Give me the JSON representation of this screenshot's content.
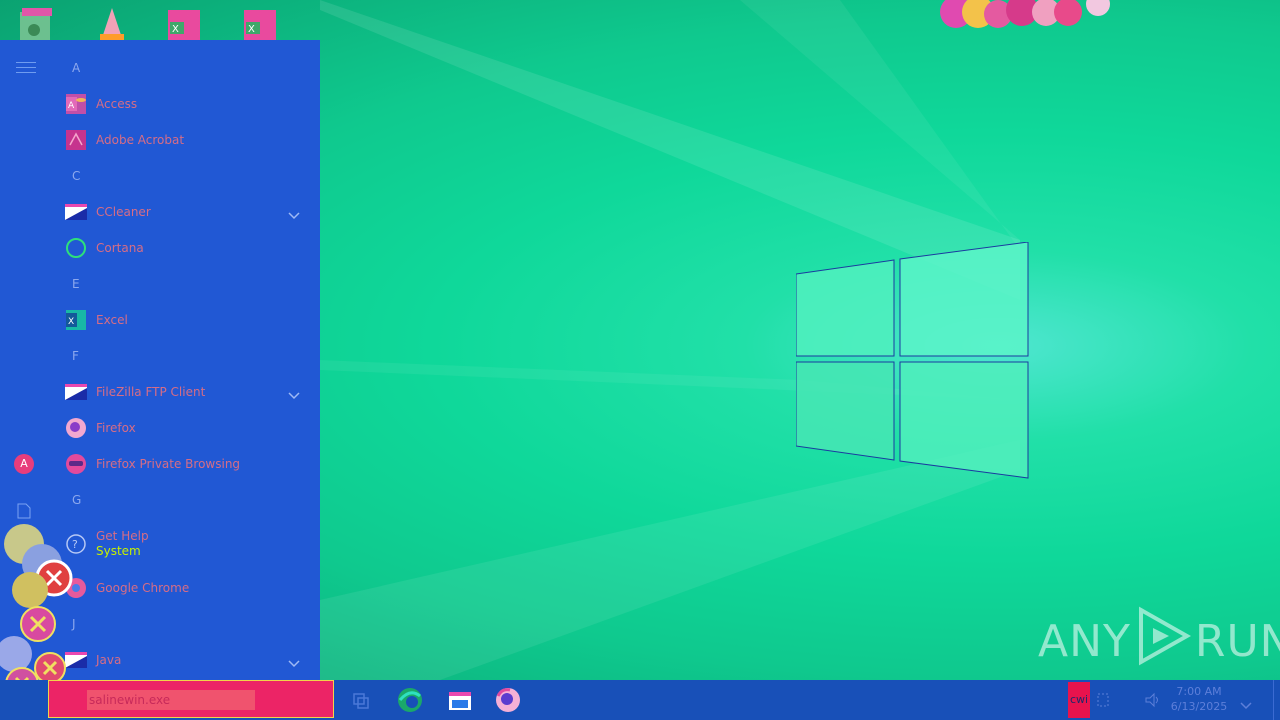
{
  "start_menu": {
    "rail": {
      "avatar_letter": "A"
    },
    "groups": [
      {
        "letter": "A",
        "apps": [
          {
            "label": "Access"
          },
          {
            "label": "Adobe Acrobat"
          }
        ]
      },
      {
        "letter": "C",
        "apps": [
          {
            "label": "CCleaner"
          },
          {
            "label": "Cortana"
          }
        ]
      },
      {
        "letter": "E",
        "apps": [
          {
            "label": "Excel"
          }
        ]
      },
      {
        "letter": "F",
        "apps": [
          {
            "label": "FileZilla FTP Client"
          },
          {
            "label": "Firefox"
          },
          {
            "label": "Firefox Private Browsing"
          }
        ]
      },
      {
        "letter": "G",
        "apps": [
          {
            "label": "Get Help",
            "sub": "System"
          },
          {
            "label": "Google Chrome"
          }
        ]
      },
      {
        "letter": "J",
        "apps": [
          {
            "label": "Java"
          }
        ]
      }
    ]
  },
  "taskbar": {
    "search_value": "salinewin.exe",
    "tray_app_label": "cwi",
    "clock_time": "7:00 AM",
    "clock_date": "6/13/2025"
  },
  "watermark": {
    "left": "ANY",
    "right": "RUN"
  },
  "colors": {
    "start_bg": "#2158d4",
    "taskbar_bg": "#1850b8",
    "search_bg": "#ec2466",
    "desktop": "#0fd89a"
  }
}
